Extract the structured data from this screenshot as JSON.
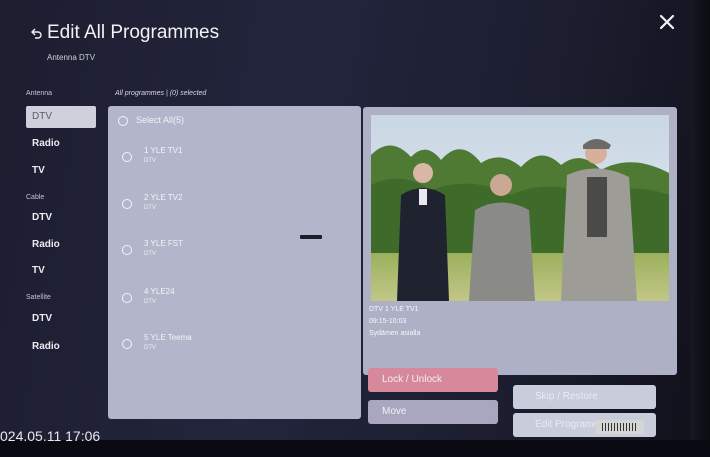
{
  "header": {
    "title": "Edit All Programmes",
    "subtitle": "Antenna DTV"
  },
  "sidebar": {
    "groups": [
      {
        "label": "Antenna",
        "items": [
          "DTV",
          "Radio",
          "TV"
        ]
      },
      {
        "label": "Cable",
        "items": [
          "DTV",
          "Radio",
          "TV"
        ]
      },
      {
        "label": "Satellite",
        "items": [
          "DTV",
          "Radio"
        ]
      }
    ],
    "active_item": "Antenna DTV"
  },
  "list": {
    "header": "All programmes | (0) selected",
    "select_all": "Select All(5)",
    "channels": [
      {
        "name": "1 YLE TV1",
        "type": "DTV"
      },
      {
        "name": "2 YLE TV2",
        "type": "DTV"
      },
      {
        "name": "3 YLE FST",
        "type": "DTV"
      },
      {
        "name": "4 YLE24",
        "type": "DTV"
      },
      {
        "name": "5 YLE Teema",
        "type": "DTV"
      }
    ]
  },
  "preview": {
    "channel": "DTV 1 YLE TV1",
    "time": "09:15-10:03",
    "programme": "Sydämen asialla"
  },
  "actions": {
    "lock": "Lock / Unlock",
    "move": "Move",
    "skip": "Skip / Restore",
    "edit": "Edit Programme"
  },
  "status": {
    "datetime": "024.05.11 17:06"
  },
  "colors": {
    "panel": "#b3b6ca",
    "lock_button": "#d7889a",
    "selected_sidebar": "#cfd0dc"
  }
}
